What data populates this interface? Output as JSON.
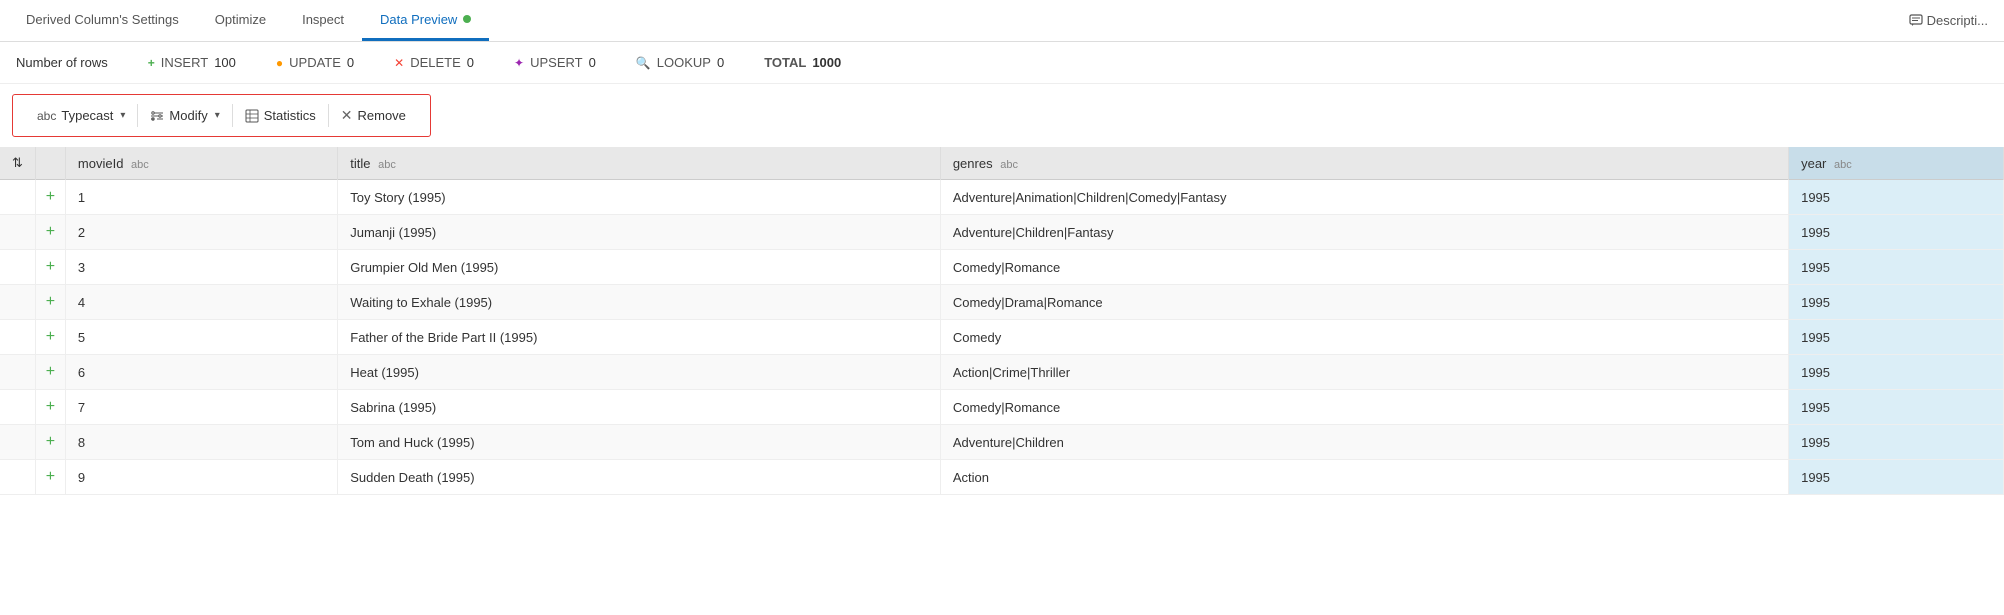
{
  "topNav": {
    "tabs": [
      {
        "label": "Derived Column's Settings",
        "active": false,
        "id": "derived-settings"
      },
      {
        "label": "Optimize",
        "active": false,
        "id": "optimize"
      },
      {
        "label": "Inspect",
        "active": false,
        "id": "inspect"
      },
      {
        "label": "Data Preview",
        "active": true,
        "id": "data-preview",
        "dot": true
      }
    ],
    "rightLabel": "Descripti..."
  },
  "statsRow": {
    "rowsLabel": "Number of rows",
    "insertLabel": "INSERT",
    "insertVal": "100",
    "updateLabel": "UPDATE",
    "updateVal": "0",
    "deleteLabel": "DELETE",
    "deleteVal": "0",
    "upsertLabel": "UPSERT",
    "upsertVal": "0",
    "lookupLabel": "LOOKUP",
    "lookupVal": "0",
    "totalLabel": "TOTAL",
    "totalVal": "1000"
  },
  "toolbar": {
    "typecastLabel": "Typecast",
    "modifyLabel": "Modify",
    "statisticsLabel": "Statistics",
    "removeLabel": "Remove"
  },
  "table": {
    "columns": [
      {
        "id": "expand",
        "label": "",
        "type": ""
      },
      {
        "id": "row-add",
        "label": "⇅",
        "type": ""
      },
      {
        "id": "movieId",
        "label": "movieId",
        "type": "abc"
      },
      {
        "id": "title",
        "label": "title",
        "type": "abc"
      },
      {
        "id": "genres",
        "label": "genres",
        "type": "abc"
      },
      {
        "id": "year",
        "label": "year",
        "type": "abc"
      }
    ],
    "rows": [
      {
        "id": "1",
        "movieId": "1",
        "title": "Toy Story (1995)",
        "genres": "Adventure|Animation|Children|Comedy|Fantasy",
        "year": "1995"
      },
      {
        "id": "2",
        "movieId": "2",
        "title": "Jumanji (1995)",
        "genres": "Adventure|Children|Fantasy",
        "year": "1995"
      },
      {
        "id": "3",
        "movieId": "3",
        "title": "Grumpier Old Men (1995)",
        "genres": "Comedy|Romance",
        "year": "1995"
      },
      {
        "id": "4",
        "movieId": "4",
        "title": "Waiting to Exhale (1995)",
        "genres": "Comedy|Drama|Romance",
        "year": "1995"
      },
      {
        "id": "5",
        "movieId": "5",
        "title": "Father of the Bride Part II (1995)",
        "genres": "Comedy",
        "year": "1995"
      },
      {
        "id": "6",
        "movieId": "6",
        "title": "Heat (1995)",
        "genres": "Action|Crime|Thriller",
        "year": "1995"
      },
      {
        "id": "7",
        "movieId": "7",
        "title": "Sabrina (1995)",
        "genres": "Comedy|Romance",
        "year": "1995"
      },
      {
        "id": "8",
        "movieId": "8",
        "title": "Tom and Huck (1995)",
        "genres": "Adventure|Children",
        "year": "1995"
      },
      {
        "id": "9",
        "movieId": "9",
        "title": "Sudden Death (1995)",
        "genres": "Action",
        "year": "1995"
      }
    ]
  }
}
